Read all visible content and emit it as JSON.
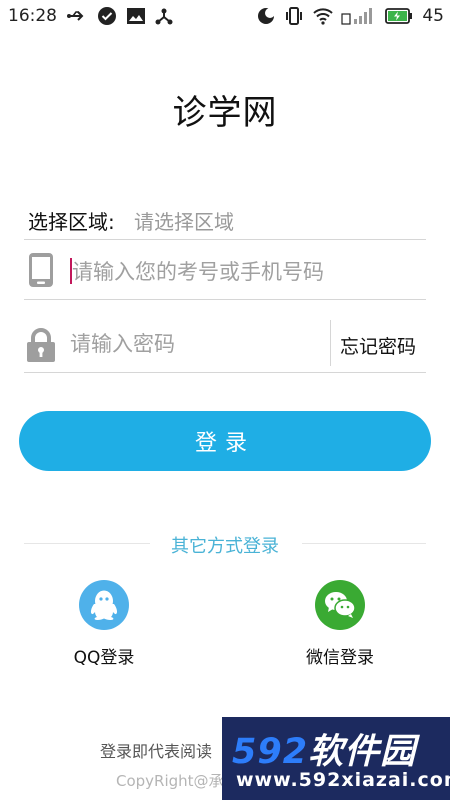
{
  "status_bar": {
    "time": "16:28",
    "battery": "45",
    "icons": [
      "usb-icon",
      "check-circle-icon",
      "image-icon",
      "share-icon",
      "do-not-disturb-icon",
      "vibrate-icon",
      "wifi-icon",
      "signal-icon",
      "battery-icon"
    ]
  },
  "app_title": "诊学网",
  "region": {
    "label": "选择区域:",
    "placeholder": "请选择区域"
  },
  "phone": {
    "placeholder": "请输入您的考号或手机号码",
    "value": ""
  },
  "password": {
    "placeholder": "请输入密码",
    "value": "",
    "forgot_label": "忘记密码"
  },
  "login_button": "登录",
  "other_login": {
    "title": "其它方式登录",
    "qq_label": "QQ登录",
    "wechat_label": "微信登录"
  },
  "colors": {
    "primary": "#1faee5",
    "qq": "#4fb1ea",
    "wechat": "#3aaa33",
    "caret": "#c2185b",
    "divider": "#d6d6d6"
  },
  "footer": {
    "agreement": "登录即代表阅读",
    "copyright": "CopyRight@承"
  },
  "watermark": {
    "brand_number": "592",
    "brand_text": "软件园",
    "url": "www.592xiazai.com"
  }
}
